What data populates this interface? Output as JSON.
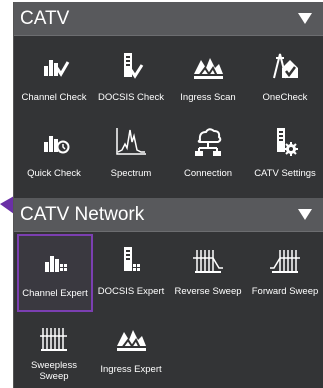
{
  "sections": [
    {
      "title": "CATV",
      "tiles": [
        {
          "label": "Channel Check",
          "icon": "channel-check-icon"
        },
        {
          "label": "DOCSIS Check",
          "icon": "docsis-check-icon"
        },
        {
          "label": "Ingress Scan",
          "icon": "ingress-scan-icon"
        },
        {
          "label": "OneCheck",
          "icon": "onecheck-icon"
        },
        {
          "label": "Quick Check",
          "icon": "quick-check-icon"
        },
        {
          "label": "Spectrum",
          "icon": "spectrum-icon"
        },
        {
          "label": "Connection",
          "icon": "connection-icon"
        },
        {
          "label": "CATV Settings",
          "icon": "catv-settings-icon"
        }
      ]
    },
    {
      "title": "CATV Network",
      "tiles": [
        {
          "label": "Channel Expert",
          "icon": "channel-expert-icon"
        },
        {
          "label": "DOCSIS Expert",
          "icon": "docsis-expert-icon"
        },
        {
          "label": "Reverse Sweep",
          "icon": "reverse-sweep-icon"
        },
        {
          "label": "Forward Sweep",
          "icon": "forward-sweep-icon"
        },
        {
          "label": "Sweepless Sweep",
          "icon": "sweepless-sweep-icon"
        },
        {
          "label": "Ingress Expert",
          "icon": "ingress-expert-icon"
        }
      ]
    }
  ],
  "colors": {
    "panel": "#333436",
    "header": "#58595c",
    "selected": "#7b3fb1"
  }
}
